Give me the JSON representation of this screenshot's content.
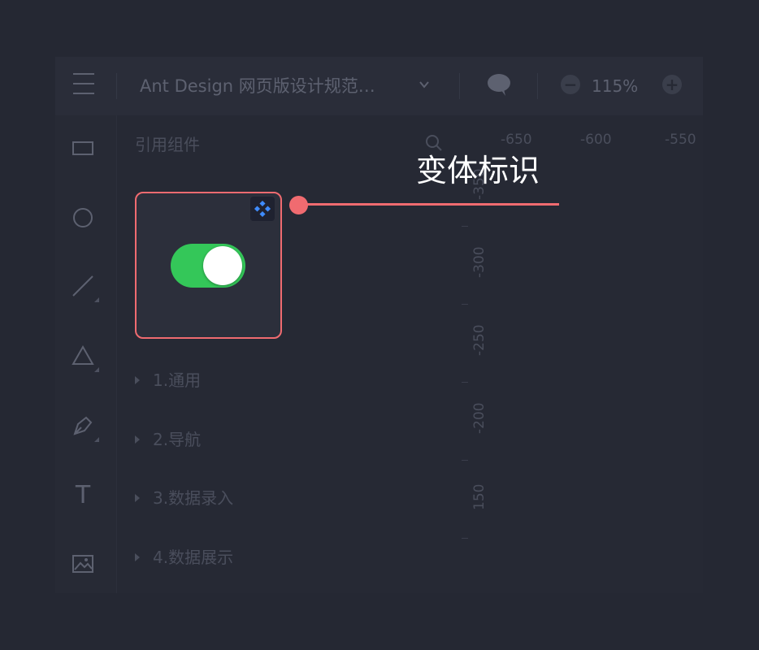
{
  "header": {
    "doc_title": "Ant Design 网页版设计规范…",
    "zoom_level": "115%",
    "zoom_out_label": "−",
    "zoom_in_label": "+"
  },
  "toolbar": {
    "tools": [
      {
        "name": "rectangle-tool",
        "icon": "rectangle-icon",
        "has_submenu": false
      },
      {
        "name": "ellipse-tool",
        "icon": "circle-icon",
        "has_submenu": false
      },
      {
        "name": "line-tool",
        "icon": "line-icon",
        "has_submenu": true
      },
      {
        "name": "polygon-tool",
        "icon": "triangle-icon",
        "has_submenu": true
      },
      {
        "name": "pen-tool",
        "icon": "pen-icon",
        "has_submenu": true
      },
      {
        "name": "text-tool",
        "icon": "text-icon",
        "has_submenu": false
      },
      {
        "name": "image-tool",
        "icon": "image-icon",
        "has_submenu": false
      }
    ],
    "text_tool_glyph": "T"
  },
  "panel": {
    "title": "引用组件",
    "categories": [
      "1.通用",
      "2.导航",
      "3.数据录入",
      "4.数据展示"
    ],
    "card": {
      "switch_state": "on",
      "switch_color": "#34c759",
      "highlight_color": "#f06b70"
    }
  },
  "ruler": {
    "horizontal": [
      "-650",
      "-600",
      "-550"
    ],
    "vertical": [
      "-350",
      "-300",
      "-250",
      "-200",
      "150"
    ]
  },
  "annotation": {
    "label": "变体标识",
    "color": "#f06b70"
  }
}
